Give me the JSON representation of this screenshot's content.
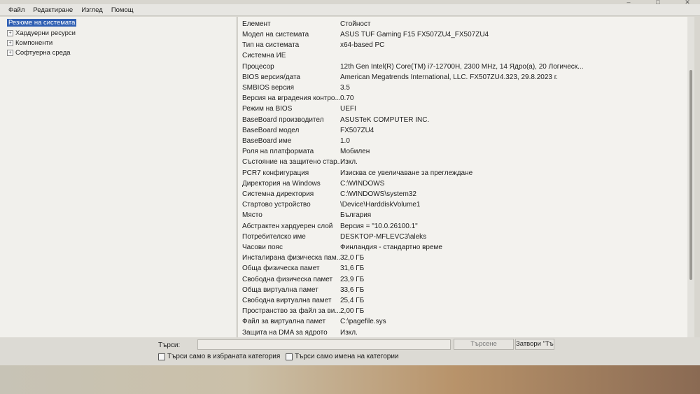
{
  "menu": [
    "Файл",
    "Редактиране",
    "Изглед",
    "Помощ"
  ],
  "tree": [
    {
      "label": "Резюме на системата",
      "expander": "",
      "selected": true
    },
    {
      "label": "Хардуерни ресурси",
      "expander": "+",
      "selected": false
    },
    {
      "label": "Компоненти",
      "expander": "+",
      "selected": false
    },
    {
      "label": "Софтуерна среда",
      "expander": "+",
      "selected": false
    }
  ],
  "table": {
    "headers": [
      "Елемент",
      "Стойност"
    ],
    "rows": [
      [
        "Модел на системата",
        "ASUS TUF Gaming F15 FX507ZU4_FX507ZU4"
      ],
      [
        "Тип на системата",
        "x64-based PC"
      ],
      [
        "Системна ИЕ",
        ""
      ],
      [
        "Процесор",
        "12th Gen Intel(R) Core(TM) i7-12700H, 2300 MHz, 14 Ядро(а), 20 Логическ..."
      ],
      [
        "BIOS версия/дата",
        "American Megatrends International, LLC. FX507ZU4.323, 29.8.2023 г."
      ],
      [
        "SMBIOS версия",
        "3.5"
      ],
      [
        "Версия на вградения контро...",
        "0.70"
      ],
      [
        "Режим на BIOS",
        "UEFI"
      ],
      [
        "BaseBoard производител",
        "ASUSTeK COMPUTER INC."
      ],
      [
        "BaseBoard модел",
        "FX507ZU4"
      ],
      [
        "BaseBoard име",
        "1.0"
      ],
      [
        "Роля на платформата",
        "Мобилен"
      ],
      [
        "Състояние на защитено стар...",
        "Изкл."
      ],
      [
        "PCR7 конфигурация",
        "Изисква се увеличаване за преглеждане"
      ],
      [
        "Директория на Windows",
        "C:\\WINDOWS"
      ],
      [
        "Системна директория",
        "C:\\WINDOWS\\system32"
      ],
      [
        "Стартово устройство",
        "\\Device\\HarddiskVolume1"
      ],
      [
        "Място",
        "България"
      ],
      [
        "Абстрактен хардуерен слой",
        "Версия = \"10.0.26100.1\""
      ],
      [
        "Потребителско име",
        "DESKTOP-MFLEVC3\\aleks"
      ],
      [
        "Часови пояс",
        "Финландия - стандартно време"
      ],
      [
        "Инсталирана физическа пам...",
        "32,0 ГБ"
      ],
      [
        "Обща физическа памет",
        "31,6 ГБ"
      ],
      [
        "Свободна физическа памет",
        "23,9 ГБ"
      ],
      [
        "Обща виртуална памет",
        "33,6 ГБ"
      ],
      [
        "Свободна виртуална памет",
        "25,4 ГБ"
      ],
      [
        "Пространство за файл за ви...",
        "2,00 ГБ"
      ],
      [
        "Файл за виртуална памет",
        "C:\\pagefile.sys"
      ],
      [
        "Защита на DMA за ядрото",
        "Изкл."
      ]
    ]
  },
  "search": {
    "label": "Търси:",
    "value": "",
    "search_button": "Търсене",
    "close_button": "Затвори \"Търсене\"",
    "option_selected": "Търси само в избраната категория",
    "option_names": "Търси само имена на категории"
  }
}
